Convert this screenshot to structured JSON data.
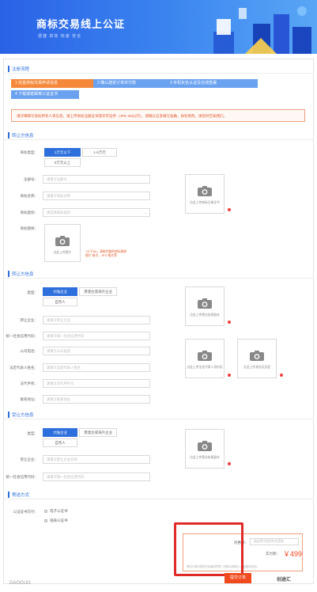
{
  "header": {
    "title": "商标交易线上公证",
    "subtitle": "便捷 高效 快速 安全"
  },
  "sections": {
    "process": "注册流程",
    "transferor": "转让方信息",
    "transferee": "受让方信息",
    "delivery": "寄送方式"
  },
  "steps": [
    "1 完善商标交易申请信息",
    "2 确认建受订单并付款",
    "3 手机实名认证及在线签署",
    "4 下载或者邮寄公证证书"
  ],
  "notice": "请仔细填写商标所有人等信息，请上传商标注册证书或许可证件（JPG 2M以内），请确认信息填写准确，如有更改，请及时告知我们。",
  "transferor": {
    "size_label": "商标类型：",
    "size_opts": [
      "1万元以下",
      "1-5万元",
      "5万元以上"
    ],
    "reg_label": "注册号：",
    "reg_ph": "请填写注册号",
    "name_label": "商标名称：",
    "name_ph": "请填写商标名称",
    "class_label": "商标类别：",
    "class_ph": "请选择商标类别",
    "img_label": "商标图样：",
    "img_caption": "点此上传图片",
    "img_tip": "*小于2M，清晰完整的商标图样\n图片 格式：JPG 格式等",
    "cert_caption": "点此上传商标注册证书"
  },
  "transferor_party": {
    "type_label": "类型：",
    "type_opts": [
      "大陆企业",
      "港澳台或海外企业",
      "自然人"
    ],
    "company_label": "转让企业：",
    "company_ph": "请填写转让企业",
    "credit_label": "统一社会信用代码：",
    "credit_ph": "请填写统一社会信用代码",
    "phone_label": "公司电话：",
    "phone_ph": "请填写公司电话",
    "legal_label": "法定代表人姓名：",
    "legal_ph": "请填写法定代表人姓名",
    "mobile_label": "法代手机：",
    "mobile_ph": "请填写法代手机号",
    "address_label": "联系地址：",
    "address_ph": "请填写联系地址",
    "license_caption": "点此上传营业执照副本",
    "id_front_caption": "点此上传法定代表人身份证",
    "id_back_caption": "点此上传身份证反面"
  },
  "transferee_party": {
    "type_label": "类型：",
    "type_opts": [
      "大陆企业",
      "港澳台或海外企业",
      "自然人"
    ],
    "company_label": "受让企业：",
    "company_ph": "请填写受让企业名称",
    "credit_label": "统一社会信用代码：",
    "credit_ph": "请填写统一社会信用代码",
    "license_caption": "点此上传营业执照副本"
  },
  "delivery": {
    "label": "公证证书交付：",
    "opt1": "电子公证书",
    "opt2": "纸质公证书"
  },
  "price": {
    "coupon_label": "优惠券：",
    "coupon_ph": "请选择可使用的优惠券",
    "total_label": "实付款：",
    "total": "￥499",
    "note": "提交订单代表您已阅读并同意《商标交易线上公证服务协议》"
  },
  "submit": "提交订单",
  "watermark_left": "DAOGUO",
  "watermark_right": "创途汇",
  "icons": {
    "camera": "camera-icon"
  }
}
